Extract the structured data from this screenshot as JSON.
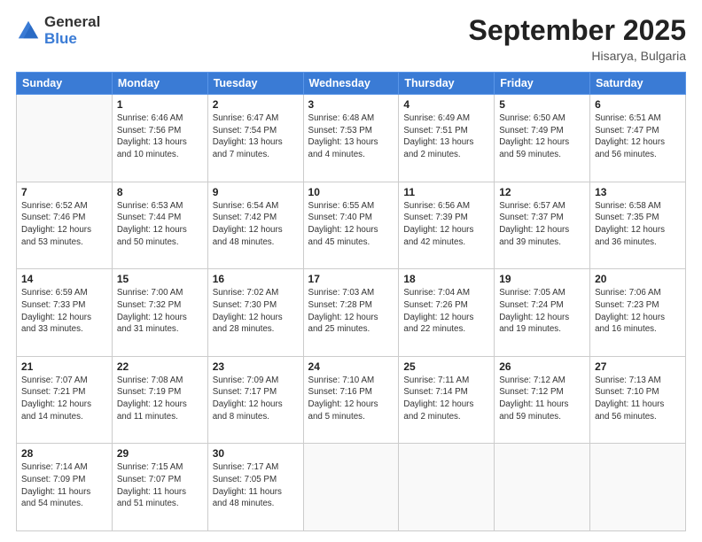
{
  "header": {
    "logo_general": "General",
    "logo_blue": "Blue",
    "title": "September 2025",
    "location": "Hisarya, Bulgaria"
  },
  "weekdays": [
    "Sunday",
    "Monday",
    "Tuesday",
    "Wednesday",
    "Thursday",
    "Friday",
    "Saturday"
  ],
  "weeks": [
    [
      {
        "day": "",
        "info": ""
      },
      {
        "day": "1",
        "info": "Sunrise: 6:46 AM\nSunset: 7:56 PM\nDaylight: 13 hours\nand 10 minutes."
      },
      {
        "day": "2",
        "info": "Sunrise: 6:47 AM\nSunset: 7:54 PM\nDaylight: 13 hours\nand 7 minutes."
      },
      {
        "day": "3",
        "info": "Sunrise: 6:48 AM\nSunset: 7:53 PM\nDaylight: 13 hours\nand 4 minutes."
      },
      {
        "day": "4",
        "info": "Sunrise: 6:49 AM\nSunset: 7:51 PM\nDaylight: 13 hours\nand 2 minutes."
      },
      {
        "day": "5",
        "info": "Sunrise: 6:50 AM\nSunset: 7:49 PM\nDaylight: 12 hours\nand 59 minutes."
      },
      {
        "day": "6",
        "info": "Sunrise: 6:51 AM\nSunset: 7:47 PM\nDaylight: 12 hours\nand 56 minutes."
      }
    ],
    [
      {
        "day": "7",
        "info": "Sunrise: 6:52 AM\nSunset: 7:46 PM\nDaylight: 12 hours\nand 53 minutes."
      },
      {
        "day": "8",
        "info": "Sunrise: 6:53 AM\nSunset: 7:44 PM\nDaylight: 12 hours\nand 50 minutes."
      },
      {
        "day": "9",
        "info": "Sunrise: 6:54 AM\nSunset: 7:42 PM\nDaylight: 12 hours\nand 48 minutes."
      },
      {
        "day": "10",
        "info": "Sunrise: 6:55 AM\nSunset: 7:40 PM\nDaylight: 12 hours\nand 45 minutes."
      },
      {
        "day": "11",
        "info": "Sunrise: 6:56 AM\nSunset: 7:39 PM\nDaylight: 12 hours\nand 42 minutes."
      },
      {
        "day": "12",
        "info": "Sunrise: 6:57 AM\nSunset: 7:37 PM\nDaylight: 12 hours\nand 39 minutes."
      },
      {
        "day": "13",
        "info": "Sunrise: 6:58 AM\nSunset: 7:35 PM\nDaylight: 12 hours\nand 36 minutes."
      }
    ],
    [
      {
        "day": "14",
        "info": "Sunrise: 6:59 AM\nSunset: 7:33 PM\nDaylight: 12 hours\nand 33 minutes."
      },
      {
        "day": "15",
        "info": "Sunrise: 7:00 AM\nSunset: 7:32 PM\nDaylight: 12 hours\nand 31 minutes."
      },
      {
        "day": "16",
        "info": "Sunrise: 7:02 AM\nSunset: 7:30 PM\nDaylight: 12 hours\nand 28 minutes."
      },
      {
        "day": "17",
        "info": "Sunrise: 7:03 AM\nSunset: 7:28 PM\nDaylight: 12 hours\nand 25 minutes."
      },
      {
        "day": "18",
        "info": "Sunrise: 7:04 AM\nSunset: 7:26 PM\nDaylight: 12 hours\nand 22 minutes."
      },
      {
        "day": "19",
        "info": "Sunrise: 7:05 AM\nSunset: 7:24 PM\nDaylight: 12 hours\nand 19 minutes."
      },
      {
        "day": "20",
        "info": "Sunrise: 7:06 AM\nSunset: 7:23 PM\nDaylight: 12 hours\nand 16 minutes."
      }
    ],
    [
      {
        "day": "21",
        "info": "Sunrise: 7:07 AM\nSunset: 7:21 PM\nDaylight: 12 hours\nand 14 minutes."
      },
      {
        "day": "22",
        "info": "Sunrise: 7:08 AM\nSunset: 7:19 PM\nDaylight: 12 hours\nand 11 minutes."
      },
      {
        "day": "23",
        "info": "Sunrise: 7:09 AM\nSunset: 7:17 PM\nDaylight: 12 hours\nand 8 minutes."
      },
      {
        "day": "24",
        "info": "Sunrise: 7:10 AM\nSunset: 7:16 PM\nDaylight: 12 hours\nand 5 minutes."
      },
      {
        "day": "25",
        "info": "Sunrise: 7:11 AM\nSunset: 7:14 PM\nDaylight: 12 hours\nand 2 minutes."
      },
      {
        "day": "26",
        "info": "Sunrise: 7:12 AM\nSunset: 7:12 PM\nDaylight: 11 hours\nand 59 minutes."
      },
      {
        "day": "27",
        "info": "Sunrise: 7:13 AM\nSunset: 7:10 PM\nDaylight: 11 hours\nand 56 minutes."
      }
    ],
    [
      {
        "day": "28",
        "info": "Sunrise: 7:14 AM\nSunset: 7:09 PM\nDaylight: 11 hours\nand 54 minutes."
      },
      {
        "day": "29",
        "info": "Sunrise: 7:15 AM\nSunset: 7:07 PM\nDaylight: 11 hours\nand 51 minutes."
      },
      {
        "day": "30",
        "info": "Sunrise: 7:17 AM\nSunset: 7:05 PM\nDaylight: 11 hours\nand 48 minutes."
      },
      {
        "day": "",
        "info": ""
      },
      {
        "day": "",
        "info": ""
      },
      {
        "day": "",
        "info": ""
      },
      {
        "day": "",
        "info": ""
      }
    ]
  ]
}
